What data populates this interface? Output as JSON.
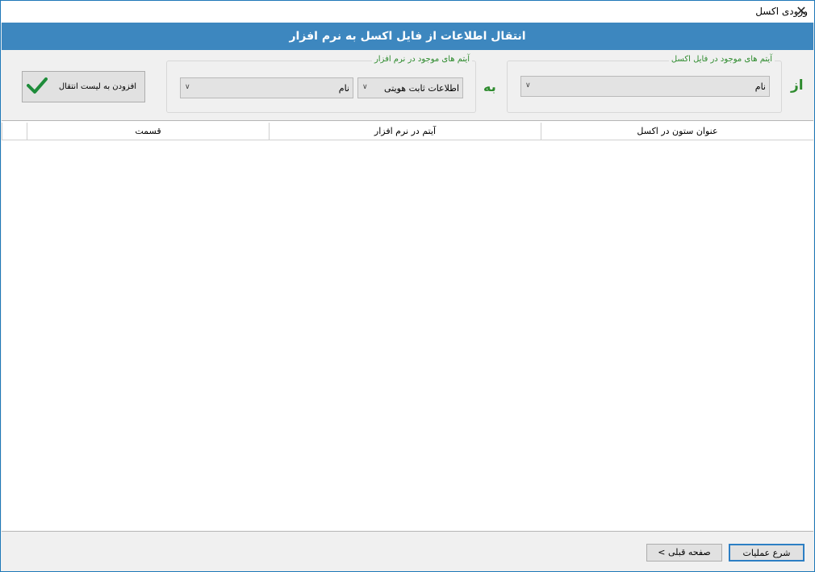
{
  "window": {
    "title": "ورودی اکسل",
    "close_glyph": "✕"
  },
  "banner": {
    "text": "انتقال اطلاعات از فایل اکسل به نرم افزار"
  },
  "source": {
    "from_label": "از",
    "group_title": "آیتم های موجود در فایل اکسل",
    "select_value": "نام"
  },
  "target": {
    "to_label": "به",
    "group_title": "آیتم های موجود در نرم افزار",
    "category_value": "اطلاعات ثابت هویتی",
    "item_value": "نام"
  },
  "add_button": {
    "label": "افزودن به لیست انتقال",
    "icon": "check-icon",
    "icon_color": "#1e8c3a"
  },
  "table": {
    "columns": [
      "عنوان ستون در اکسل",
      "آیتم در نرم افزار",
      "قسمت"
    ]
  },
  "footer": {
    "start_label": "شرع عملیات",
    "prev_label": "صفحه قبلی  >"
  },
  "colors": {
    "banner": "#3d87bf",
    "accent_green": "#2e8b2e",
    "border_blue": "#1e78b8"
  }
}
